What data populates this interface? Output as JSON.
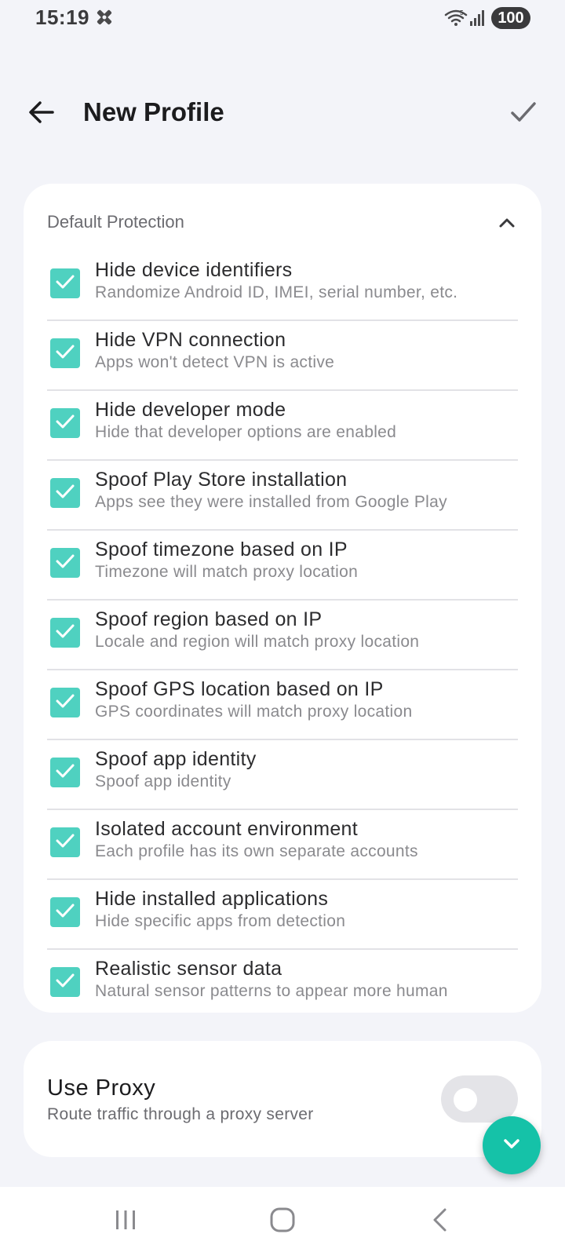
{
  "status_bar": {
    "time": "15:19",
    "battery": "100",
    "icons": [
      "notification-icon",
      "wifi-icon",
      "signal-icon"
    ]
  },
  "header": {
    "title": "New Profile",
    "back_icon": "arrow-left-icon",
    "confirm_icon": "check-icon"
  },
  "protection": {
    "section_title": "Default Protection",
    "collapse_icon": "chevron-up-icon",
    "options": [
      {
        "title": "Hide device identifiers",
        "description": "Randomize Android ID, IMEI, serial number, etc.",
        "checked": true
      },
      {
        "title": "Hide VPN connection",
        "description": "Apps won't detect VPN is active",
        "checked": true
      },
      {
        "title": "Hide developer mode",
        "description": "Hide that developer options are enabled",
        "checked": true
      },
      {
        "title": "Spoof Play Store installation",
        "description": "Apps see they were installed from Google Play",
        "checked": true
      },
      {
        "title": "Spoof timezone based on IP",
        "description": "Timezone will match proxy location",
        "checked": true
      },
      {
        "title": "Spoof region based on IP",
        "description": "Locale and region will match proxy location",
        "checked": true
      },
      {
        "title": "Spoof GPS location based on IP",
        "description": "GPS coordinates will match proxy location",
        "checked": true
      },
      {
        "title": "Spoof app identity",
        "description": "Spoof app identity",
        "checked": true
      },
      {
        "title": "Isolated account environment",
        "description": "Each profile has its own separate accounts",
        "checked": true
      },
      {
        "title": "Hide installed applications",
        "description": "Hide specific apps from detection",
        "checked": true
      },
      {
        "title": "Realistic sensor data",
        "description": "Natural sensor patterns to appear more human",
        "checked": true
      }
    ]
  },
  "proxy": {
    "title": "Use Proxy",
    "description": "Route traffic through a proxy server",
    "enabled": false
  },
  "fab": {
    "icon": "chevron-down-icon"
  },
  "nav_bar": {
    "items": [
      "recents-icon",
      "home-icon",
      "back-icon"
    ]
  },
  "colors": {
    "accent": "#4fd1c0",
    "fab": "#15c2a8",
    "background": "#f3f4f9",
    "card": "#ffffff"
  }
}
